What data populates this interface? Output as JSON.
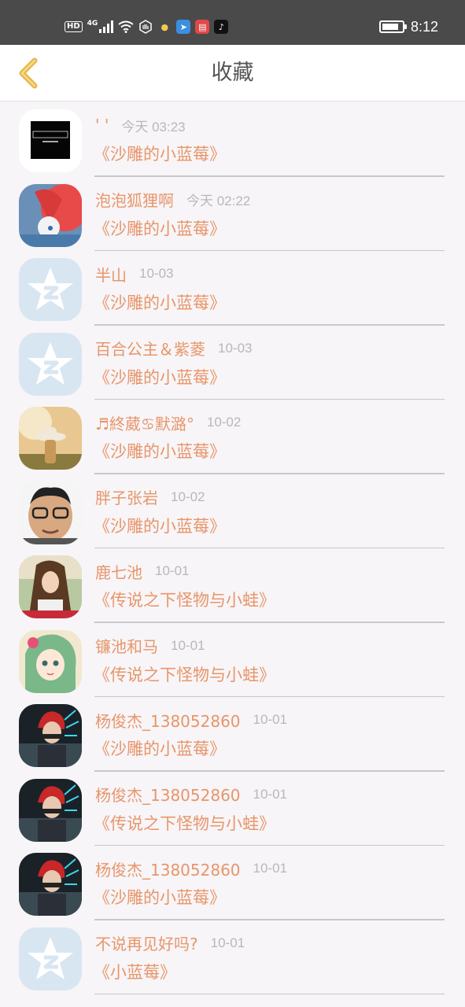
{
  "status_bar": {
    "hd": "HD",
    "network": "4G",
    "time": "8:12",
    "battery_level": 0.85
  },
  "header": {
    "title": "收藏"
  },
  "favorites": [
    {
      "name": "' '",
      "time": "今天 03:23",
      "book": "《沙雕的小蓝莓》",
      "avatar": "ixlive-logo"
    },
    {
      "name": "泡泡狐狸啊",
      "time": "今天 02:22",
      "book": "《沙雕的小蓝莓》",
      "avatar": "red-fox-art"
    },
    {
      "name": "半山",
      "time": "10-03",
      "book": "《沙雕的小蓝莓》",
      "avatar": "default-star"
    },
    {
      "name": "百合公主＆紫菱",
      "time": "10-03",
      "book": "《沙雕的小蓝莓》",
      "avatar": "default-star"
    },
    {
      "name": "♬終葳♋默潞°",
      "time": "10-02",
      "book": "《沙雕的小蓝莓》",
      "avatar": "girl-hat-photo"
    },
    {
      "name": "胖子张岩",
      "time": "10-02",
      "book": "《沙雕的小蓝莓》",
      "avatar": "glasses-man-cartoon"
    },
    {
      "name": "鹿七池",
      "time": "10-01",
      "book": "《传说之下怪物与小蛙》",
      "avatar": "girl-photo"
    },
    {
      "name": "镰池和马",
      "time": "10-01",
      "book": "《传说之下怪物与小蛙》",
      "avatar": "anime-girl"
    },
    {
      "name": "杨俊杰_138052860",
      "time": "10-01",
      "book": "《沙雕的小蓝莓》",
      "avatar": "red-hair-character"
    },
    {
      "name": "杨俊杰_138052860",
      "time": "10-01",
      "book": "《传说之下怪物与小蛙》",
      "avatar": "red-hair-character"
    },
    {
      "name": "杨俊杰_138052860",
      "time": "10-01",
      "book": "《沙雕的小蓝莓》",
      "avatar": "red-hair-character"
    },
    {
      "name": "不说再见好吗?",
      "time": "10-01",
      "book": "《小蓝莓》",
      "avatar": "default-star"
    }
  ],
  "colors": {
    "accent": "#e8956b",
    "back_arrow": "#e8b84a",
    "time_gray": "#b8b8b8"
  }
}
